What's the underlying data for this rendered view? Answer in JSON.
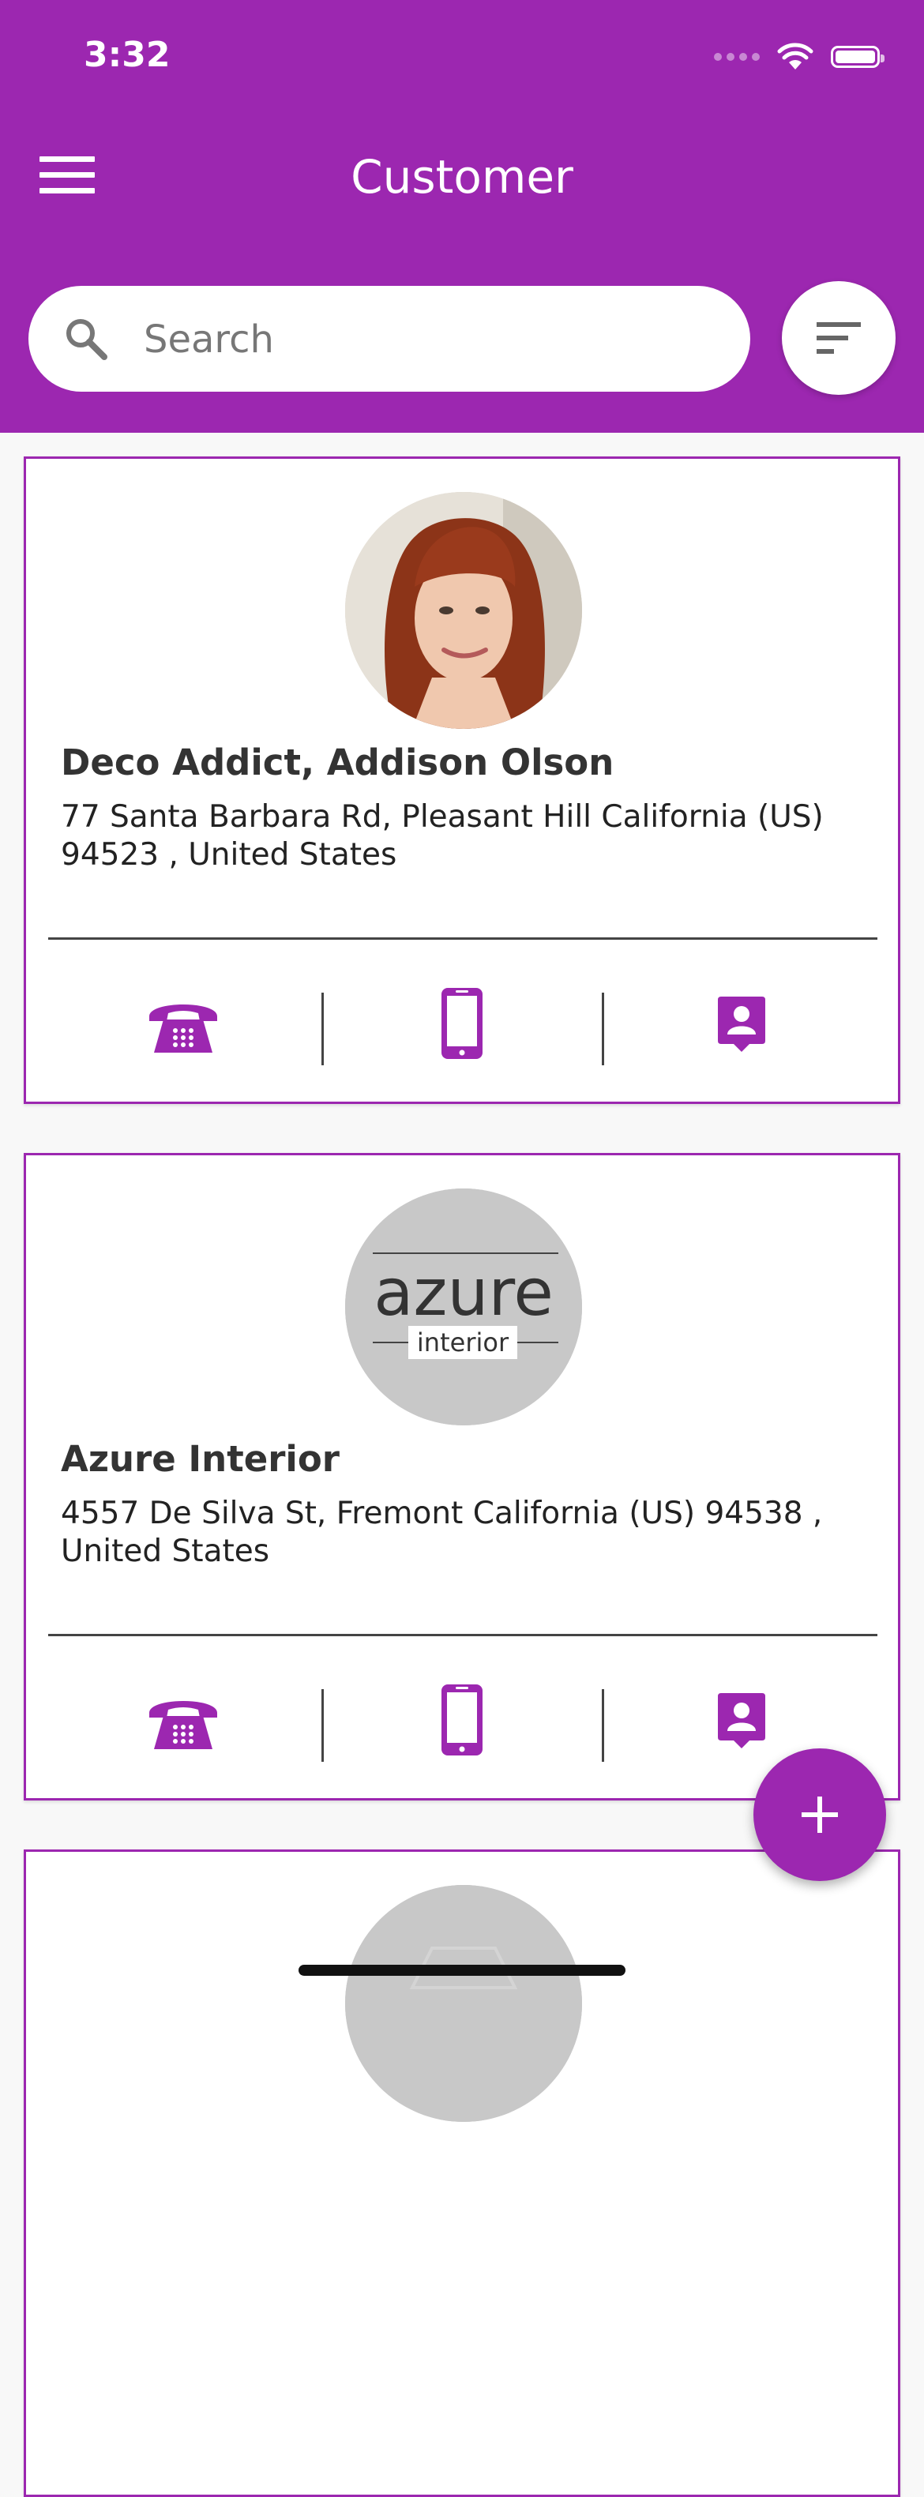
{
  "status_bar": {
    "time": "3:32"
  },
  "header": {
    "title": "Customer"
  },
  "search": {
    "placeholder": "Search",
    "value": ""
  },
  "customers": [
    {
      "name": "Deco Addict, Addison Olson",
      "address": "77 Santa Barbara Rd,  Pleasant Hill California (US) 94523 , United States",
      "avatar": "person-photo"
    },
    {
      "name": "Azure Interior",
      "address": "4557 De Silva St,  Fremont California (US) 94538 , United States",
      "avatar": "azure-interior-logo",
      "logo_text": {
        "main": "azure",
        "sub": "interior"
      }
    },
    {
      "name": "",
      "address": "",
      "avatar": "placeholder-avatar"
    }
  ],
  "actions": [
    "phone-icon",
    "mobile-icon",
    "contact-card-icon"
  ],
  "colors": {
    "primary": "#9c27b0",
    "background": "#f8f8f8",
    "card_border": "#9c27b0"
  }
}
